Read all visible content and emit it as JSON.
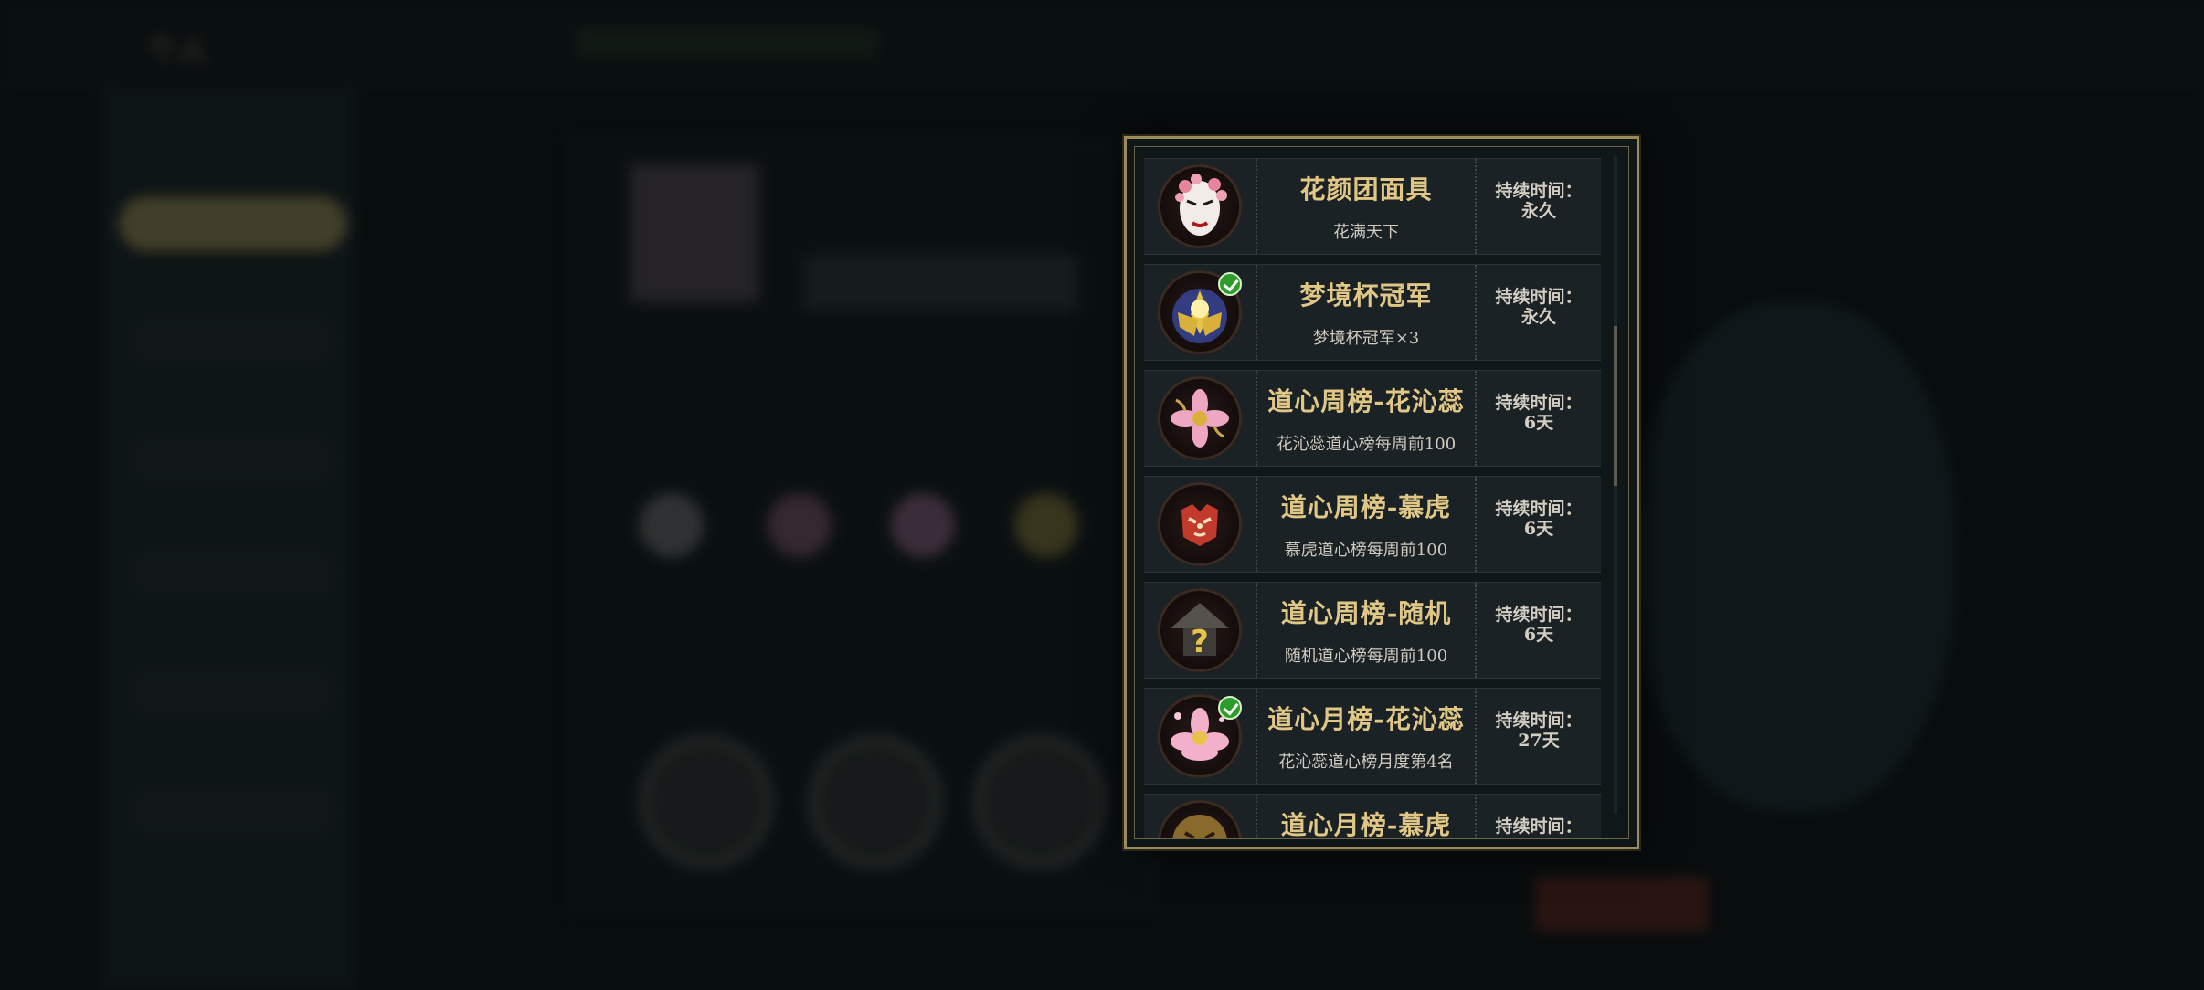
{
  "background": {
    "topbar_title": "个人"
  },
  "popup": {
    "items": [
      {
        "name": "花颜团面具",
        "desc": "花满天下",
        "time_label": "持续时间：",
        "time_value": "永久",
        "icon": "flower-mask-icon",
        "owned": false
      },
      {
        "name": "梦境杯冠军",
        "desc": "梦境杯冠军×3",
        "time_label": "持续时间：",
        "time_value": "永久",
        "icon": "golden-lotus-icon",
        "owned": true
      },
      {
        "name": "道心周榜-花沁蕊",
        "desc": "花沁蕊道心榜每周前100",
        "time_label": "持续时间：",
        "time_value": "6天",
        "icon": "pink-flower-icon",
        "owned": false
      },
      {
        "name": "道心周榜-慕虎",
        "desc": "慕虎道心榜每周前100",
        "time_label": "持续时间：",
        "time_value": "6天",
        "icon": "tiger-emblem-icon",
        "owned": false
      },
      {
        "name": "道心周榜-随机",
        "desc": "随机道心榜每周前100",
        "time_label": "持续时间：",
        "time_value": "6天",
        "icon": "mystery-hat-icon",
        "owned": false
      },
      {
        "name": "道心月榜-花沁蕊",
        "desc": "花沁蕊道心榜月度第4名",
        "time_label": "持续时间：",
        "time_value": "27天",
        "icon": "pink-lotus-icon",
        "owned": true
      },
      {
        "name": "道心月榜-慕虎",
        "desc": "",
        "time_label": "持续时间：",
        "time_value": "",
        "icon": "tiger-gold-icon",
        "owned": false
      }
    ]
  }
}
